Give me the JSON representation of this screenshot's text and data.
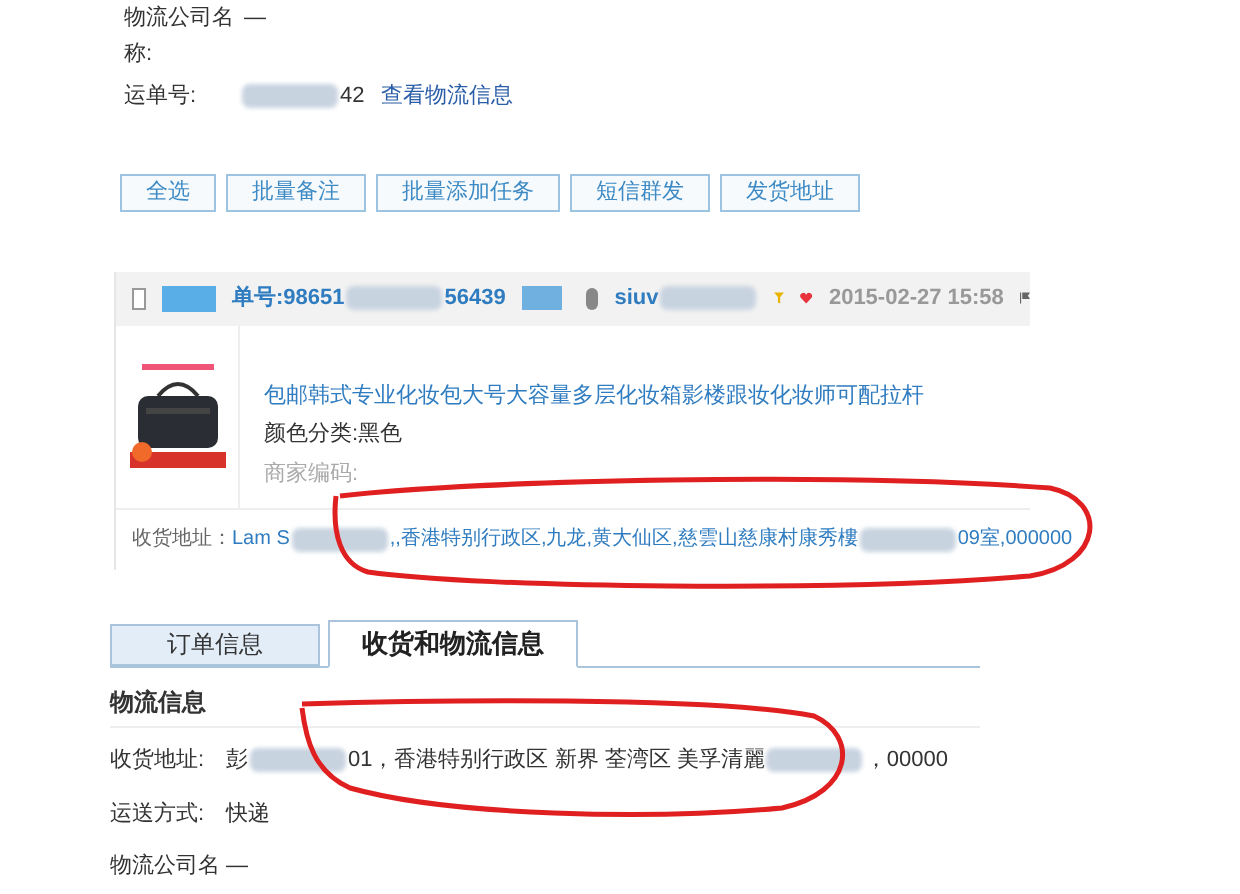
{
  "top_info": {
    "company_label": "物流公司名称:",
    "company_value": "—",
    "waybill_label": "运单号:",
    "waybill": [
      {
        "kind": "redacted"
      },
      {
        "kind": "text",
        "text": "42"
      }
    ],
    "track_link": "查看物流信息"
  },
  "batch_buttons": [
    "全选",
    "批量备注",
    "批量添加任务",
    "短信群发",
    "发货地址"
  ],
  "order": {
    "checked": false,
    "order_no": [
      {
        "kind": "text",
        "text": "单号:98651"
      },
      {
        "kind": "redacted"
      },
      {
        "kind": "text",
        "text": "56439"
      }
    ],
    "buyer": [
      {
        "kind": "text",
        "text": "siuv"
      },
      {
        "kind": "redacted"
      }
    ],
    "date": "2015-02-27 15:58",
    "item": {
      "kind": "picture",
      "title": "包邮韩式专业化妆包大号大容量多层化妆箱影楼跟妆化妆师可配拉杆",
      "spec": "颜色分类:黑色",
      "code_label": "商家编码:"
    },
    "address_label": "收货地址：",
    "address": [
      {
        "kind": "text",
        "text": "Lam S"
      },
      {
        "kind": "redacted"
      },
      {
        "kind": "text",
        "text": ",,香港特别行政区,九龙,黄大仙区,慈雲山慈康村康秀樓"
      },
      {
        "kind": "redacted"
      },
      {
        "kind": "text",
        "text": "09室,000000"
      }
    ]
  },
  "tabs": [
    {
      "label": "订单信息",
      "selected": false
    },
    {
      "label": "收货和物流信息",
      "selected": true
    }
  ],
  "logistics": {
    "heading": "物流信息",
    "rows": [
      {
        "label": "收货地址:",
        "value": [
          {
            "kind": "text",
            "text": "彭"
          },
          {
            "kind": "redacted"
          },
          {
            "kind": "text",
            "text": "01，香港特别行政区 新界 荃湾区 美孚清麗"
          },
          {
            "kind": "redacted"
          },
          {
            "kind": "text",
            "text": "，00000"
          }
        ]
      },
      {
        "label": "运送方式:",
        "value": [
          {
            "kind": "text",
            "text": "快递"
          }
        ]
      },
      {
        "label": "物流公司名",
        "value": [
          {
            "kind": "text",
            "text": "—"
          }
        ]
      }
    ]
  }
}
